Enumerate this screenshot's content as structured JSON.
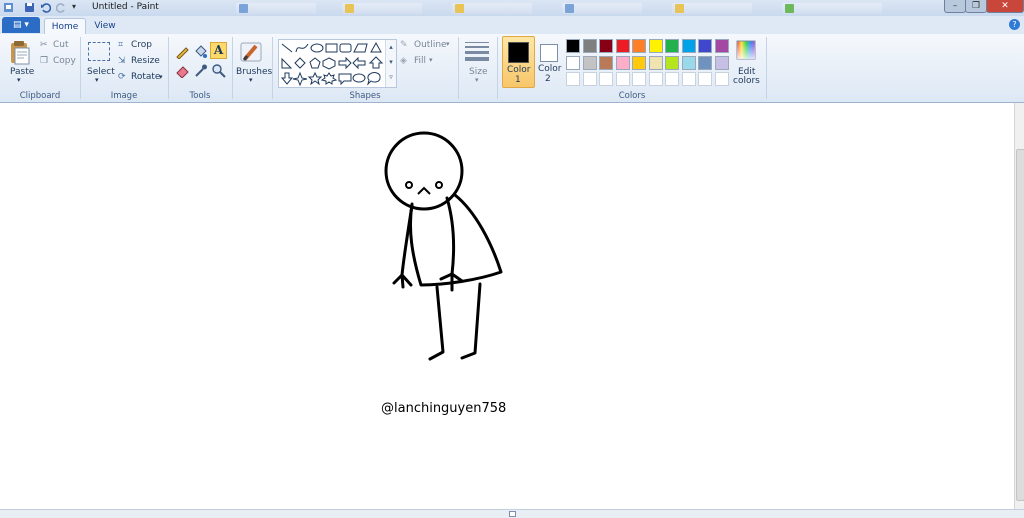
{
  "window": {
    "title": "Untitled - Paint",
    "minimize": "–",
    "restore": "❐",
    "close": "✕"
  },
  "menu": {
    "file_label": "▤ ▾",
    "tabs": [
      {
        "label": "Home"
      },
      {
        "label": "View"
      }
    ],
    "help": "?"
  },
  "ribbon": {
    "clipboard": {
      "paste": "Paste",
      "cut": "Cut",
      "copy": "Copy",
      "group": "Clipboard"
    },
    "image": {
      "select": "Select",
      "crop": "Crop",
      "resize": "Resize",
      "rotate": "Rotate",
      "group": "Image"
    },
    "tools": {
      "group": "Tools"
    },
    "brushes": {
      "label": "Brushes"
    },
    "shapes": {
      "outline": "Outline",
      "fill": "Fill",
      "group": "Shapes"
    },
    "size": {
      "label": "Size"
    },
    "colors": {
      "color1": "Color",
      "color1_num": "1",
      "color2": "Color",
      "color2_num": "2",
      "edit": "Edit",
      "edit2": "colors",
      "group": "Colors",
      "color1_value": "#000000",
      "color2_value": "#ffffff",
      "palette_row1": [
        "#000000",
        "#7f7f7f",
        "#880015",
        "#ed1c24",
        "#ff7f27",
        "#fff200",
        "#22b14c",
        "#00a2e8",
        "#3f48cc",
        "#a349a4"
      ],
      "palette_row2": [
        "#ffffff",
        "#c3c3c3",
        "#b97a57",
        "#ffaec9",
        "#ffc90e",
        "#efe4b0",
        "#b5e61d",
        "#99d9ea",
        "#7092be",
        "#c8bfe7"
      ]
    }
  },
  "canvas": {
    "signature": "@lanchinguyen758"
  }
}
